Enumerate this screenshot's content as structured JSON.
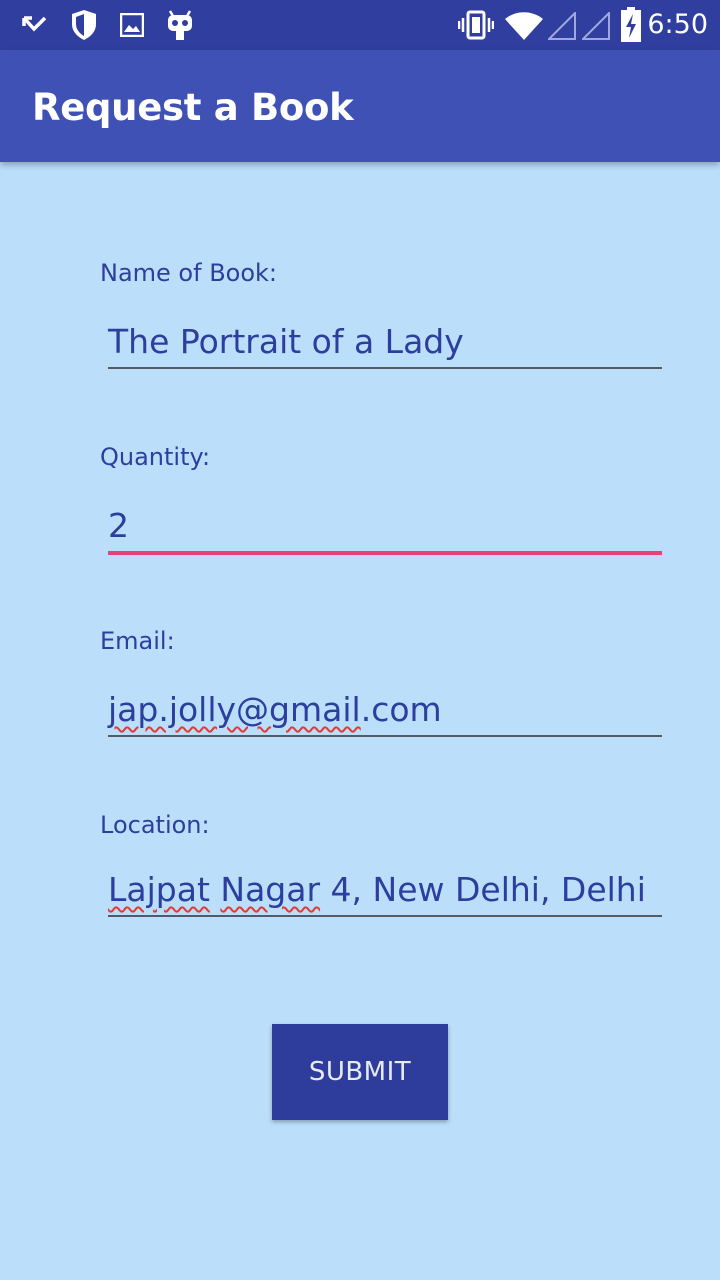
{
  "status_bar": {
    "time": "6:50",
    "icons": [
      "missed-call-icon",
      "shield-icon",
      "image-icon",
      "android-bot-icon",
      "vibrate-icon",
      "wifi-icon",
      "signal-icon",
      "signal-icon",
      "battery-charging-icon"
    ]
  },
  "app_bar": {
    "title": "Request a Book"
  },
  "form": {
    "book_label": "Name of Book:",
    "book_value": "The Portrait of a Lady",
    "quantity_label": "Quantity:",
    "quantity_value": "2",
    "email_label": "Email:",
    "email_value_misspelled": "jap.jolly@gmail",
    "email_value_rest": ".com",
    "location_label": "Location:",
    "location_word1": "Lajpat",
    "location_space1": " ",
    "location_word2": "Nagar",
    "location_rest": " 4, New Delhi, Delhi"
  },
  "submit_label": "SUBMIT",
  "colors": {
    "background": "#bbdefa",
    "app_bar": "#3f51b5",
    "status_bar": "#303f9f",
    "accent": "#e8417a",
    "text": "#2c3e9e",
    "button": "#2e3d9c"
  }
}
